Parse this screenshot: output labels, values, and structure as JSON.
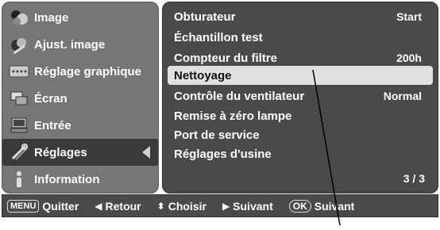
{
  "left_menu": {
    "items": [
      {
        "label": "Image",
        "icon": "image-icon"
      },
      {
        "label": "Ajust. image",
        "icon": "image-adjust-icon"
      },
      {
        "label": "Réglage graphique",
        "icon": "display-icon"
      },
      {
        "label": "Écran",
        "icon": "screen-icon"
      },
      {
        "label": "Entrée",
        "icon": "input-icon"
      },
      {
        "label": "Réglages",
        "icon": "tools-icon"
      },
      {
        "label": "Information",
        "icon": "info-icon"
      }
    ],
    "selected_index": 5
  },
  "settings": {
    "rows": [
      {
        "label": "Obturateur",
        "value": "Start"
      },
      {
        "label": "Échantillon test",
        "value": ""
      },
      {
        "label": "Compteur du filtre",
        "value": "200h"
      },
      {
        "label": "Nettoyage",
        "value": ""
      },
      {
        "label": "Contrôle du ventilateur",
        "value": "Normal"
      },
      {
        "label": "Remise à zéro lampe",
        "value": ""
      },
      {
        "label": "Port de service",
        "value": ""
      },
      {
        "label": "Réglages d'usine",
        "value": ""
      }
    ],
    "highlighted_index": 3,
    "page": "3 / 3"
  },
  "bottom_bar": {
    "menu_key": "MENU",
    "quit": "Quitter",
    "back": "Retour",
    "choose": "Choisir",
    "next": "Suivant",
    "ok_key": "OK",
    "ok_next": "Suivant"
  },
  "colors": {
    "left_panel": "#767676",
    "right_panel": "#4a4a4a",
    "highlight": "#e0e0e0"
  }
}
